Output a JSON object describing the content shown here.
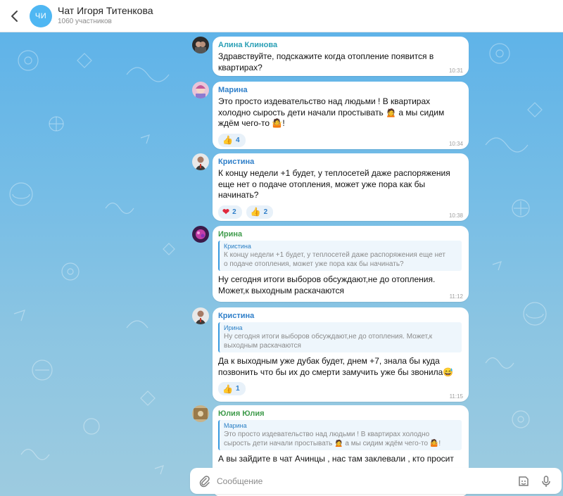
{
  "header": {
    "avatar_initials": "ЧИ",
    "title": "Чат Игоря Титенкова",
    "subtitle": "1060 участников"
  },
  "messages": [
    {
      "sender": "Алина Клинова",
      "lines": [
        "Здравствуйте, подскажите когда отопление появится в",
        "квартирах?"
      ],
      "time": "10:31"
    },
    {
      "sender": "Марина",
      "lines": [
        "Это просто издевательство над людьми ! В квартирах",
        "холодно сырость дети начали простывать",
        "а мы сидим",
        "ждём чего-то"
      ],
      "reaction_count": "4",
      "time": "10:34"
    },
    {
      "sender": "Кристина",
      "lines": [
        "К концу недели +1 будет, у теплосетей даже распоряжения",
        "еще нет о подаче отопления, может уже пора как бы",
        "начинать?"
      ],
      "reaction_heart_count": "2",
      "reaction_like_count": "2",
      "time": "10:38"
    },
    {
      "sender": "Ирина",
      "reply_name": "Кристина",
      "reply_lines": [
        "К концу недели +1 будет, у теплосетей даже распоряжения еще нет",
        "о подаче отопления, может уже пора как бы начинать?"
      ],
      "lines": [
        "Ну сегодня итоги выборов обсуждают,не до отопления.",
        "Может,к выходным раскачаются"
      ],
      "time": "11:12"
    },
    {
      "sender": "Кристина",
      "reply_name": "Ирина",
      "reply_lines": [
        "Ну сегодня итоги выборов обсуждают,не до отопления. Может,к",
        "выходным раскачаются"
      ],
      "lines": [
        "Да к выходным уже дубак будет, днем +7, знала бы куда",
        "позвонить что бы их до смерти замучить уже бы звонила"
      ],
      "reaction_count": "1",
      "time": "11:15"
    },
    {
      "sender": "Юлия Юлия",
      "reply_name": "Марина",
      "reply_lines": [
        "Это просто издевательство над людьми ! В квартирах холодно",
        "сырость дети начали простывать",
        "а мы сидим ждём чего-то"
      ],
      "lines": [
        "А вы зайдите в чат Ачинцы , нас там заклевали  , кто просит"
      ]
    }
  ],
  "composer": {
    "placeholder": "Сообщение"
  },
  "colors": {
    "accent": "#3b9be0",
    "background_top": "#5fb3e8",
    "background_bottom": "#9dcbe0"
  }
}
